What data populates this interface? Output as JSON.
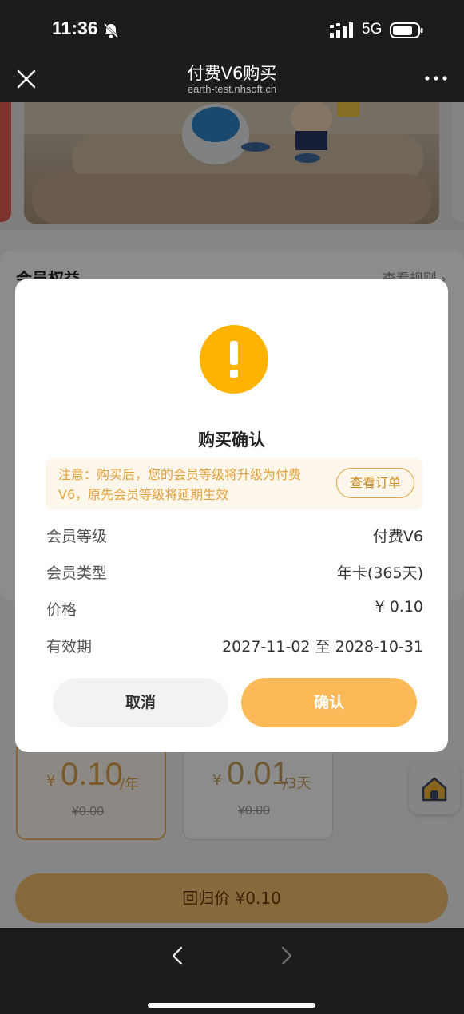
{
  "status_bar": {
    "time": "11:36",
    "network": "5G"
  },
  "nav": {
    "title": "付费V6购买",
    "subtitle": "earth-test.nhsoft.cn"
  },
  "section": {
    "title": "会员权益",
    "rules_link": "查看规则 ›"
  },
  "price_cards": [
    {
      "currency": "¥",
      "price": "0.10",
      "unit": "/年",
      "original": "¥0.00",
      "selected": true
    },
    {
      "currency": "¥",
      "price": "0.01",
      "unit": "/3天",
      "original": "¥0.00",
      "selected": false
    }
  ],
  "buy_button": {
    "label": "回归价 ¥0.10"
  },
  "modal": {
    "title": "购买确认",
    "notice": "注意：购买后，您的会员等级将升级为付费V6，原先会员等级将延期生效",
    "view_order": "查看订单",
    "rows": [
      {
        "label": "会员等级",
        "value": "付费V6"
      },
      {
        "label": "会员类型",
        "value": "年卡(365天)"
      },
      {
        "label": "价格",
        "value": "¥ 0.10"
      },
      {
        "label": "有效期",
        "value": "2027-11-02 至 2028-10-31"
      }
    ],
    "cancel": "取消",
    "confirm": "确认"
  },
  "colors": {
    "accent": "#fbb957",
    "warning_icon": "#fdb300",
    "notice_bg": "#fdf6ea",
    "notice_text": "#e3a23c"
  },
  "icons": {
    "close": "close-icon",
    "more": "more-icon",
    "warning": "warning-icon",
    "home": "home-icon",
    "back": "chevron-left-icon",
    "forward": "chevron-right-icon"
  }
}
